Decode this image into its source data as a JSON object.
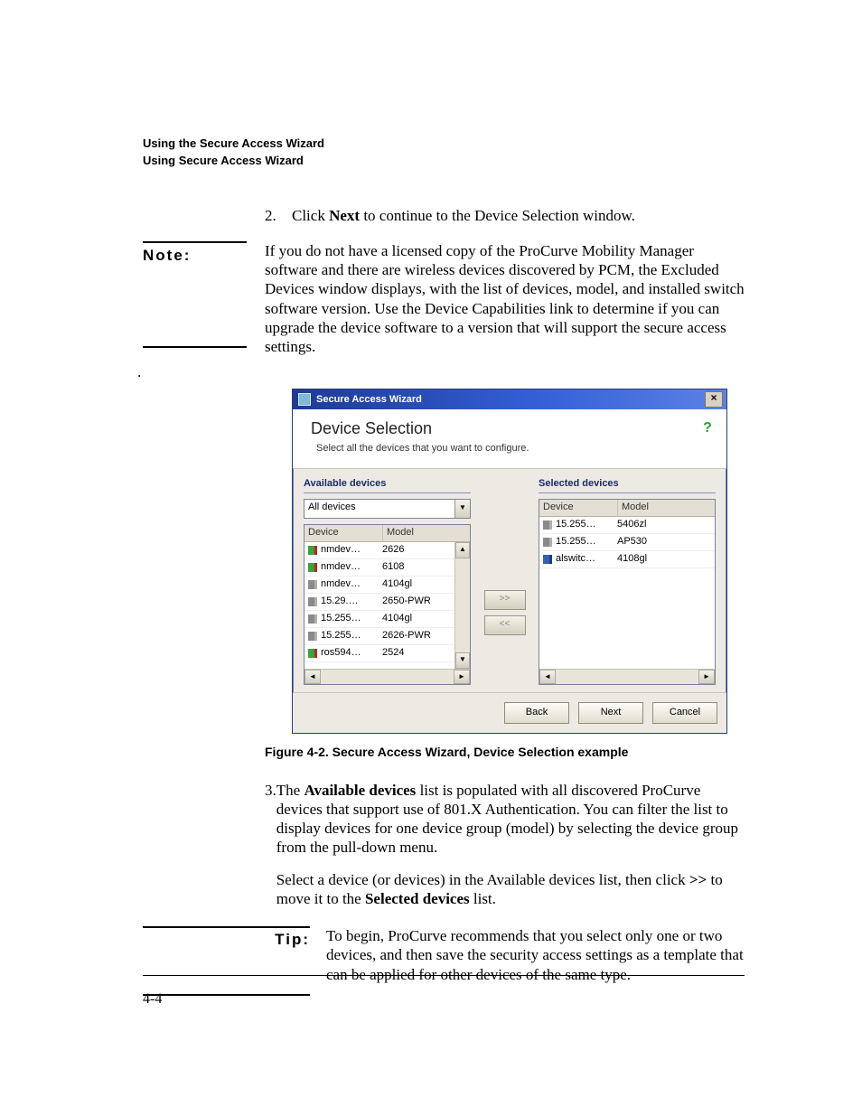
{
  "running_head": {
    "line1": "Using the Secure Access Wizard",
    "line2": "Using Secure Access Wizard"
  },
  "step2": {
    "num": "2.",
    "prefix": "Click ",
    "bold": "Next",
    "suffix": " to continue to the Device Selection window."
  },
  "note": {
    "label": "Note:",
    "text": "If you do not have a licensed copy of the ProCurve Mobility Manager software and there are wireless devices discovered by PCM, the Excluded Devices window displays, with the list of devices, model, and installed switch software version. Use the Device Capabilities link to determine if you can upgrade the device software to a version that will support the secure access settings."
  },
  "stray_dot": ".",
  "wizard": {
    "title": "Secure Access Wizard",
    "heading": "Device Selection",
    "subtitle": "Select all the devices that you want to configure.",
    "help_glyph": "?",
    "close_glyph": "×",
    "available_label": "Available devices",
    "selected_label": "Selected devices",
    "filter_value": "All devices",
    "col_device": "Device",
    "col_model": "Model",
    "col_device_cut": "Device",
    "available_rows": [
      {
        "device": "nmdev…",
        "model": "2626",
        "sw": ""
      },
      {
        "device": "nmdev…",
        "model": "6108",
        "sw": ""
      },
      {
        "device": "nmdev…",
        "model": "4104gl",
        "sw": "gray"
      },
      {
        "device": "15.29.…",
        "model": "2650-PWR",
        "sw": "gray"
      },
      {
        "device": "15.255…",
        "model": "4104gl",
        "sw": "gray"
      },
      {
        "device": "15.255…",
        "model": "2626-PWR",
        "sw": "gray"
      },
      {
        "device": "ros594…",
        "model": "2524",
        "sw": ""
      }
    ],
    "selected_rows": [
      {
        "device": "15.255…",
        "model": "5406zl",
        "sw": "gray"
      },
      {
        "device": "15.255…",
        "model": "AP530",
        "sw": "gray"
      },
      {
        "device": "alswitc…",
        "model": "4108gl",
        "sw": "blue"
      }
    ],
    "move_right": ">>",
    "move_left": "<<",
    "btn_back": "Back",
    "btn_next": "Next",
    "btn_cancel": "Cancel"
  },
  "figure_caption": "Figure 4-2. Secure Access Wizard, Device Selection example",
  "step3": {
    "num": "3.",
    "p1_prefix": "The ",
    "p1_bold1": "Available devices",
    "p1_mid": " list is populated with all discovered ProCurve devices that support use of 801.X Authentication. You can filter the list to display devices for one device group (model) by selecting the device group from the pull-down menu.",
    "p2_prefix": "Select a device (or devices) in the Available devices list, then click ",
    "p2_bold1": ">>",
    "p2_mid": " to move it to the ",
    "p2_bold2": "Selected devices",
    "p2_suffix": " list."
  },
  "tip": {
    "label": "Tip:",
    "text": "To begin, ProCurve recommends that you select only one or two devices, and then save the security access settings as a template that can be applied for other devices of the same type."
  },
  "page_number": "4-4"
}
